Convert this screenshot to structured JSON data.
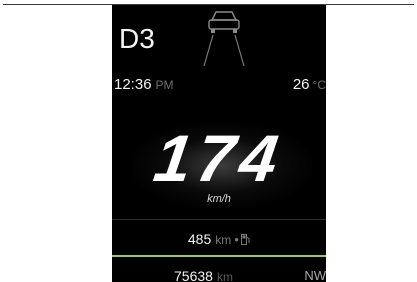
{
  "cluster": {
    "gear": "D3",
    "time": "12:36",
    "time_period": "PM",
    "temperature": "26",
    "temperature_unit": "°C",
    "speed": "174",
    "speed_unit": "km/h",
    "range": "485",
    "range_unit": "km",
    "odometer": "75638",
    "odometer_unit": "km",
    "heading": "NW"
  },
  "icons": {
    "car": "car-front-icon",
    "fuel": "fuel-pump-icon"
  },
  "colors": {
    "screen_background": "#000000",
    "primary_text": "#f2f2f2",
    "muted_text": "#6e6e6e",
    "accent_line": "#9ccc3c"
  }
}
